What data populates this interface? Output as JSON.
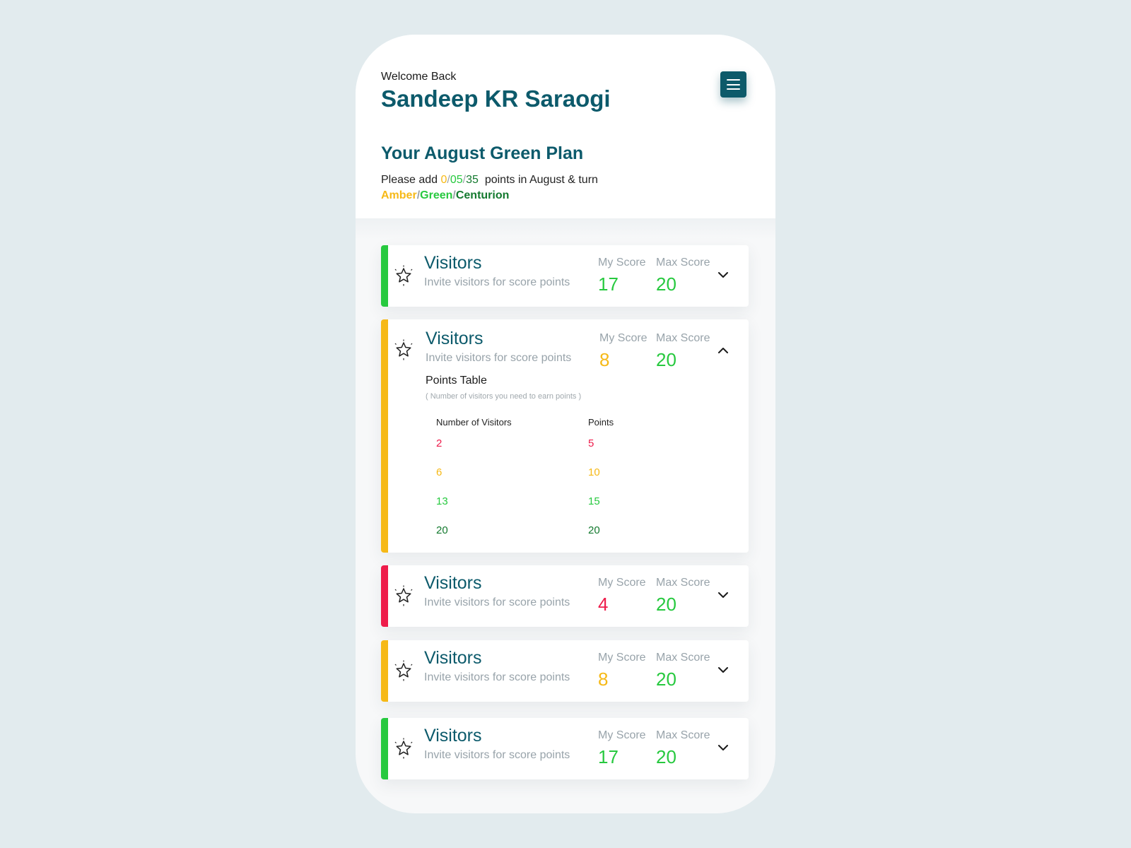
{
  "header": {
    "welcome": "Welcome Back",
    "user_name": "Sandeep KR Saraogi",
    "menu_icon": "hamburger-menu-icon"
  },
  "plan": {
    "title": "Your August Green Plan",
    "line_prefix": "Please add",
    "points_amber": "0",
    "sep1": "/",
    "points_green": "05",
    "sep2": "/",
    "points_centurion": "35",
    "line_suffix": "points in August & turn",
    "tier_amber": "Amber",
    "tier_sep1": "/",
    "tier_green": "Green",
    "tier_sep2": "/",
    "tier_centurion": "Centurion"
  },
  "colors": {
    "amber": "#f6b917",
    "green": "#27c93f",
    "dark_green": "#13792e",
    "red": "#ee1c4b",
    "teal": "#0c5a6b"
  },
  "cards": [
    {
      "status": "green",
      "title": "Visitors",
      "subtitle": "Invite visitors for score points",
      "my_score_label": "My Score",
      "my_score": "17",
      "max_score_label": "Max Score",
      "max_score": "20",
      "expanded": false
    },
    {
      "status": "amber",
      "title": "Visitors",
      "subtitle": "Invite visitors for score points",
      "my_score_label": "My Score",
      "my_score": "8",
      "max_score_label": "Max Score",
      "max_score": "20",
      "expanded": true,
      "points_table": {
        "title": "Points Table",
        "note": "( Number of visitors you need to earn points )",
        "columns": [
          "Number of Visitors",
          "Points"
        ],
        "rows": [
          {
            "visitors": "2",
            "points": "5",
            "color": "red"
          },
          {
            "visitors": "6",
            "points": "10",
            "color": "amber"
          },
          {
            "visitors": "13",
            "points": "15",
            "color": "green"
          },
          {
            "visitors": "20",
            "points": "20",
            "color": "dark_green"
          }
        ]
      }
    },
    {
      "status": "red",
      "title": "Visitors",
      "subtitle": "Invite visitors for score points",
      "my_score_label": "My Score",
      "my_score": "4",
      "max_score_label": "Max Score",
      "max_score": "20",
      "expanded": false
    },
    {
      "status": "amber",
      "title": "Visitors",
      "subtitle": "Invite visitors for score points",
      "my_score_label": "My Score",
      "my_score": "8",
      "max_score_label": "Max Score",
      "max_score": "20",
      "expanded": false
    },
    {
      "status": "green",
      "title": "Visitors",
      "subtitle": "Invite visitors for score points",
      "my_score_label": "My Score",
      "my_score": "17",
      "max_score_label": "Max Score",
      "max_score": "20",
      "expanded": false
    }
  ]
}
